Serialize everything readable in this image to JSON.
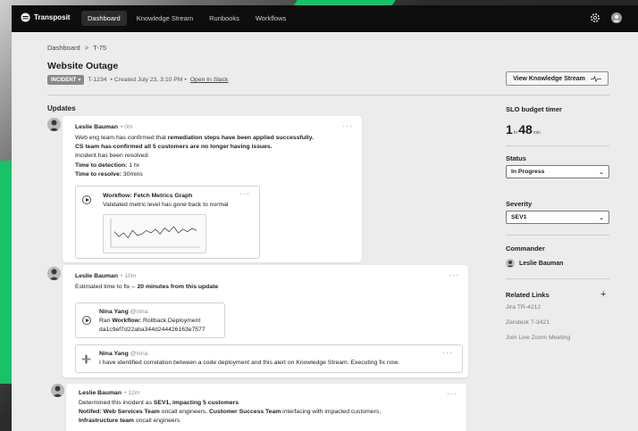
{
  "app": {
    "brand": "Transposit",
    "nav": [
      "Dashboard",
      "Knowledge Stream",
      "Runbooks",
      "Workflows"
    ],
    "active_nav": "Dashboard"
  },
  "breadcrumb": {
    "root": "Dashboard",
    "separator": ">",
    "current": "T-75"
  },
  "incident": {
    "title": "Website Outage",
    "badge": "INCIDENT",
    "id": "T-1234",
    "created": "• Created July 23, 3:10 PM •",
    "slack_link": "Open In Slack"
  },
  "view_ks_button": "View Knowledge Stream",
  "updates_heading": "Updates",
  "updates": [
    {
      "author": "Leslie Bauman",
      "time": "• 0m",
      "l1a": "Web eng team has confirmed that ",
      "l1b": "remediation steps have been applied successfully.",
      "l2": "CS team has confirmed all 5 customers are no longer having issues.",
      "l3": "Incident has been resolved.",
      "l4k": "Time to detection:",
      "l4v": " 1 hr",
      "l5k": "Time to resolve:",
      "l5v": " 30mins",
      "workflow_title": "Workflow: Fetch Metrics Graph",
      "workflow_text": "Validated metric level has gone back to normal",
      "metric_graph": [
        0.55,
        0.35,
        0.5,
        0.3,
        0.6,
        0.4,
        0.45,
        0.6,
        0.5,
        0.65,
        0.45,
        0.7,
        0.55,
        0.75,
        0.5,
        0.65,
        0.55,
        0.68,
        0.6
      ]
    },
    {
      "author": "Leslie Bauman",
      "time": "• 10m",
      "l1a": "Estimated time to fix -- ",
      "l1b": "20 minutes from this update",
      "sub1_name": "Nina Yang",
      "sub1_handle": "@nina",
      "sub1_l1a": "Ran ",
      "sub1_l1b": "Workflow:",
      "sub1_l1c": " Rollback Deployment",
      "sub1_l2": "da1c9ef7d22aba344d244426163e7577",
      "sub2_name": "Nina Yang",
      "sub2_handle": "@nina",
      "sub2_text": "I have identified correlation between a code deployment and this alert on Knowledge Stream. Executing fix now."
    },
    {
      "author": "Leslie Bauman",
      "time": "• 12m",
      "l1a": "Determined this incident as ",
      "l1b": "SEV1, impacting 5 customers",
      "l2a": "Notifed: Web Services Team",
      "l2b": " oncall engineers, ",
      "l2c": "Customer Success Team",
      "l2d": " interfacing with impacted customers,",
      "l3a": "Infrastructure team",
      "l3b": " oncall engineers"
    }
  ],
  "sidebar": {
    "slo_label": "SLO budget timer",
    "slo_hours": "1",
    "slo_hr_unit": "hr",
    "slo_minutes": "48",
    "slo_min_unit": "min",
    "status_label": "Status",
    "status_value": "In Progress",
    "severity_label": "Severity",
    "severity_value": "SEV1",
    "commander_label": "Commander",
    "commander_name": "Leslie Bauman",
    "related_label": "Related Links",
    "related_links": [
      "Jira TR-4212",
      "Zendesk T-3421",
      "Join Live Zoom Meeting"
    ]
  },
  "colors": {
    "accent_green": "#18c267",
    "topbar": "#0d0d0d",
    "panel": "#ececec"
  }
}
